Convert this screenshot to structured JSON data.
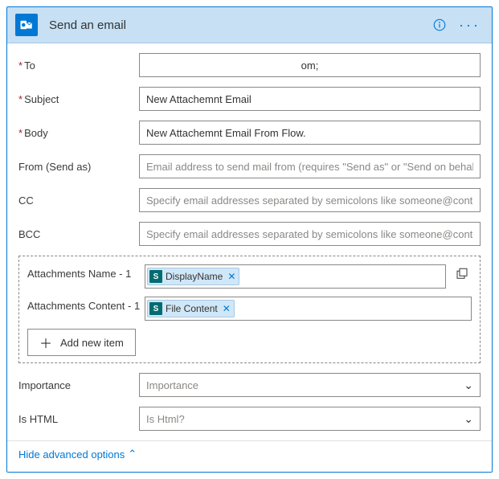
{
  "header": {
    "title": "Send an email"
  },
  "fields": {
    "to_label": "To",
    "to_value": "om;",
    "subject_label": "Subject",
    "subject_value": "New Attachemnt Email",
    "body_label": "Body",
    "body_value": "New Attachemnt Email From Flow.",
    "from_label": "From (Send as)",
    "from_placeholder": "Email address to send mail from (requires \"Send as\" or \"Send on behalf of\" pe",
    "cc_label": "CC",
    "cc_placeholder": "Specify email addresses separated by semicolons like someone@contoso.com",
    "bcc_label": "BCC",
    "bcc_placeholder": "Specify email addresses separated by semicolons like someone@contoso.com"
  },
  "attachments": {
    "name_label": "Attachments Name - 1",
    "name_token": "DisplayName",
    "content_label": "Attachments Content - 1",
    "content_token": "File Content",
    "add_label": "Add new item"
  },
  "advanced": {
    "importance_label": "Importance",
    "importance_placeholder": "Importance",
    "ishtml_label": "Is HTML",
    "ishtml_placeholder": "Is Html?"
  },
  "footer": {
    "link_label": "Hide advanced options"
  }
}
